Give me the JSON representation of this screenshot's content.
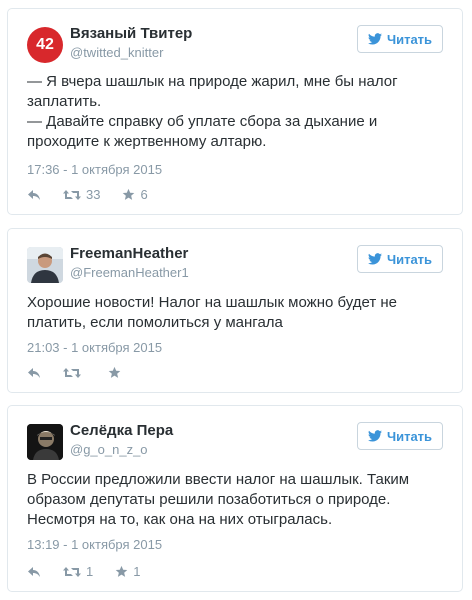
{
  "follow_label": "Читать",
  "tweets": [
    {
      "avatar_text": "42",
      "name": "Вязаный Твитер",
      "handle": "@twitted_knitter",
      "text": "— Я вчера шашлык на природе жарил, мне бы налог\nзаплатить.\n— Давайте справку об уплате сбора за дыхание и\nпроходите к жертвенному алтарю.",
      "time": "17:36 - 1 октября 2015",
      "retweets": "33",
      "likes": "6"
    },
    {
      "name": "FreemanHeather",
      "handle": "@FreemanHeather1",
      "text": "Хорошие новости! Налог на шашлык можно будет не\nплатить, если помолиться у мангала",
      "time": "21:03 - 1 октября 2015",
      "retweets": "",
      "likes": ""
    },
    {
      "name": "Селёдка Пера",
      "handle": "@g_o_n_z_o",
      "text": "В России предложили ввести налог на шашлык. Таким\nобразом депутаты решили позаботиться о природе.\nНесмотря на то, как она на них отыгралась.",
      "time": "13:19 - 1 октября 2015",
      "retweets": "1",
      "likes": "1"
    }
  ],
  "colors": {
    "twitter_blue": "#3b94d9",
    "border": "#e1e8ed",
    "muted": "#8899a6",
    "badge_red": "#d8282c"
  },
  "icons": [
    "twitter-bird-icon",
    "reply-icon",
    "retweet-icon",
    "star-icon"
  ]
}
